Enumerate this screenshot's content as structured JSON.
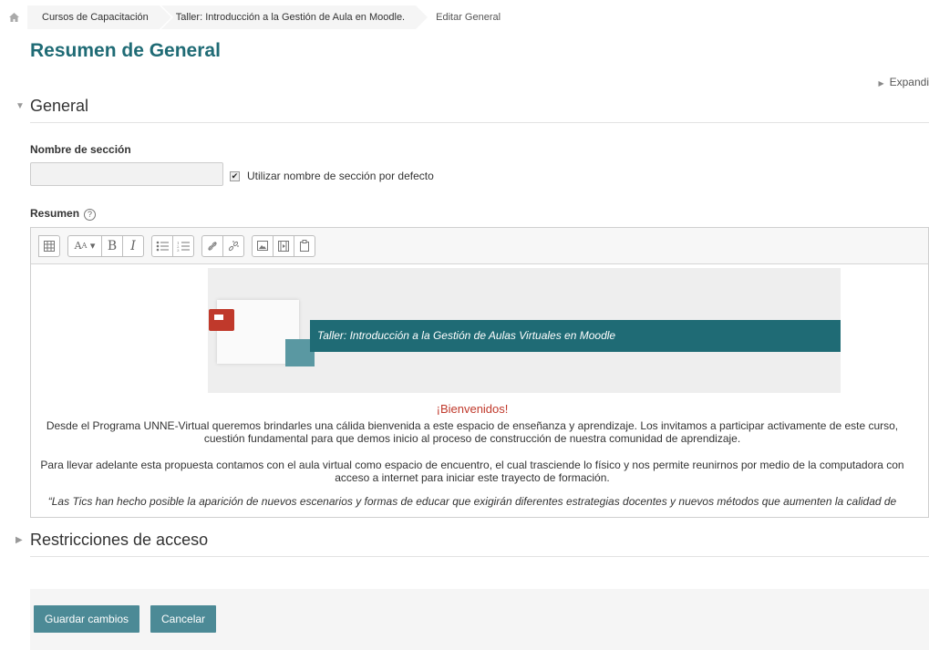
{
  "breadcrumb": {
    "home_icon": "home-icon",
    "items": [
      "Cursos de Capacitación",
      "Taller: Introducción a la Gestión de Aula en Moodle."
    ],
    "current": "Editar General"
  },
  "page_title": "Resumen de General",
  "expand_all": "Expandi",
  "section_general": {
    "title": "General"
  },
  "section_name": {
    "label": "Nombre de sección",
    "value": "",
    "use_default_label": "Utilizar nombre de sección por defecto",
    "use_default_checked": true
  },
  "summary": {
    "label": "Resumen",
    "help_icon": "help-icon",
    "toolbar": [
      "grid-icon",
      "font-size-icon",
      "bold-icon",
      "italic-icon",
      "bullet-list-icon",
      "numbered-list-icon",
      "link-icon",
      "unlink-icon",
      "image-icon",
      "media-icon",
      "paste-icon"
    ],
    "banner_text": "Taller: Introducción a la Gestión de Aulas Virtuales en Moodle",
    "welcome_title": "¡Bienvenidos!",
    "paragraph1": "Desde el Programa UNNE-Virtual queremos brindarles una cálida bienvenida a este espacio de enseñanza y aprendizaje. Los invitamos a participar activamente de este curso, cuestión fundamental para que demos inicio al proceso de construcción de nuestra comunidad de aprendizaje.",
    "paragraph2": "Para llevar adelante esta propuesta contamos con el aula virtual como espacio de encuentro, el cual trasciende lo físico y nos permite reunirnos por medio de la computadora con acceso a internet para iniciar este trayecto de formación.",
    "paragraph3": "“Las Tics han hecho posible la aparición de nuevos escenarios y formas de educar que exigirán diferentes estrategias docentes y nuevos métodos que aumenten la calidad de"
  },
  "section_access": {
    "title": "Restricciones de acceso"
  },
  "buttons": {
    "save": "Guardar cambios",
    "cancel": "Cancelar"
  },
  "colors": {
    "accent": "#1f6b75",
    "button": "#4c8a96",
    "welcome": "#c0392b"
  }
}
